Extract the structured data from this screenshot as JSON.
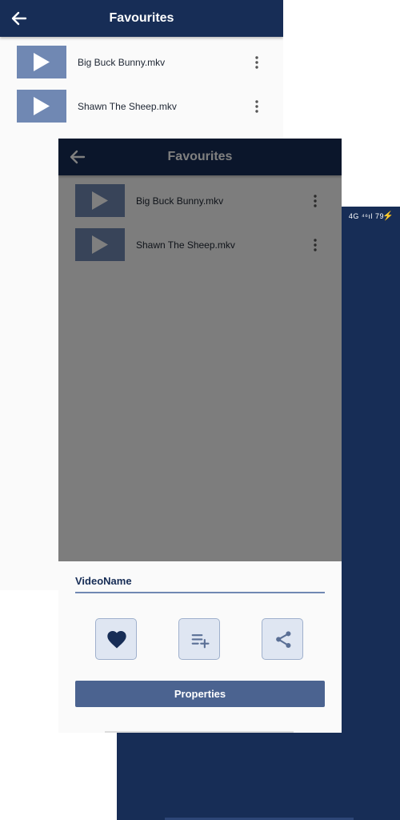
{
  "status_bar": {
    "indicators": "4G ⁴⁶ıl 79",
    "charging_icon": "bolt-icon"
  },
  "screens": [
    {
      "title": "Favourites",
      "back_icon": "arrow-left-icon",
      "items": [
        {
          "name": "Big Buck Bunny.mkv",
          "thumb_icon": "play-icon",
          "menu_icon": "more-vertical-icon"
        },
        {
          "name": "Shawn The Sheep.mkv",
          "thumb_icon": "play-icon",
          "menu_icon": "more-vertical-icon"
        }
      ]
    },
    {
      "title": "Favourites",
      "back_icon": "arrow-left-icon",
      "items": [
        {
          "name": "Big Buck Bunny.mkv",
          "thumb_icon": "play-icon",
          "menu_icon": "more-vertical-icon"
        },
        {
          "name": "Shawn The Sheep.mkv",
          "thumb_icon": "play-icon",
          "menu_icon": "more-vertical-icon"
        }
      ]
    }
  ],
  "bottom_sheet": {
    "title": "VideoName",
    "actions": [
      "heart-icon",
      "playlist-add-icon",
      "share-icon"
    ],
    "properties_label": "Properties"
  },
  "colors": {
    "primary": "#172d56",
    "thumbnail": "#7088b3",
    "button": "#4b6390",
    "action_background": "#dfe6f2"
  }
}
